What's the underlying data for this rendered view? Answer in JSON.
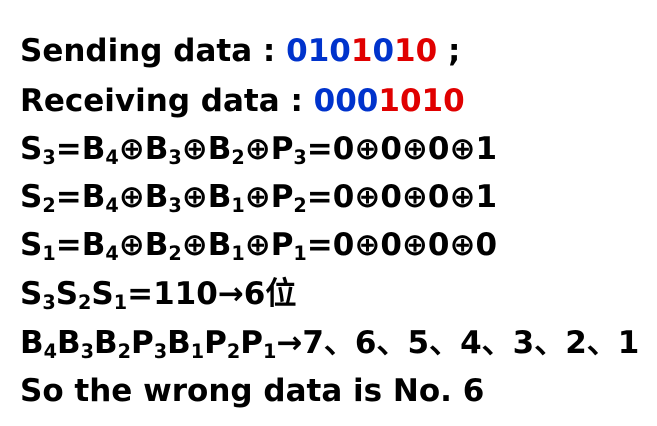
{
  "colors": {
    "blue": "#0033cc",
    "red": "#e00000",
    "text": "#000000"
  },
  "sending": {
    "label": "Sending data : ",
    "digits": [
      {
        "d": "0",
        "color": "blue"
      },
      {
        "d": "1",
        "color": "blue"
      },
      {
        "d": "0",
        "color": "blue"
      },
      {
        "d": "1",
        "color": "red"
      },
      {
        "d": "0",
        "color": "blue"
      },
      {
        "d": "1",
        "color": "red"
      },
      {
        "d": "0",
        "color": "red"
      }
    ],
    "suffix": " ;"
  },
  "receiving": {
    "label": "Receiving data : ",
    "digits": [
      {
        "d": "0",
        "color": "blue"
      },
      {
        "d": "0",
        "color": "blue"
      },
      {
        "d": "0",
        "color": "blue"
      },
      {
        "d": "1",
        "color": "red"
      },
      {
        "d": "0",
        "color": "red"
      },
      {
        "d": "1",
        "color": "red"
      },
      {
        "d": "0",
        "color": "red"
      }
    ]
  },
  "s3": {
    "lhs": [
      "S",
      "3"
    ],
    "terms": [
      [
        "B",
        "4"
      ],
      [
        "B",
        "3"
      ],
      [
        "B",
        "2"
      ],
      [
        "P",
        "3"
      ]
    ],
    "values": [
      "0",
      "0",
      "0",
      "1"
    ]
  },
  "s2": {
    "lhs": [
      "S",
      "2"
    ],
    "terms": [
      [
        "B",
        "4"
      ],
      [
        "B",
        "3"
      ],
      [
        "B",
        "1"
      ],
      [
        "P",
        "2"
      ]
    ],
    "values": [
      "0",
      "0",
      "0",
      "1"
    ]
  },
  "s1": {
    "lhs": [
      "S",
      "1"
    ],
    "terms": [
      [
        "B",
        "4"
      ],
      [
        "B",
        "2"
      ],
      [
        "B",
        "1"
      ],
      [
        "P",
        "1"
      ]
    ],
    "values": [
      "0",
      "0",
      "0",
      "0"
    ]
  },
  "syndrome": {
    "parts": [
      [
        "S",
        "3"
      ],
      [
        "S",
        "2"
      ],
      [
        "S",
        "1"
      ]
    ],
    "result": "=110→6位"
  },
  "positions": {
    "parts": [
      [
        "B",
        "4"
      ],
      [
        "B",
        "3"
      ],
      [
        "B",
        "2"
      ],
      [
        "P",
        "3"
      ],
      [
        "B",
        "1"
      ],
      [
        "P",
        "2"
      ],
      [
        "P",
        "1"
      ]
    ],
    "mapping": "→7、6、5、4、3、2、1"
  },
  "conclusion": {
    "text": "So the wrong data is No. 6"
  }
}
